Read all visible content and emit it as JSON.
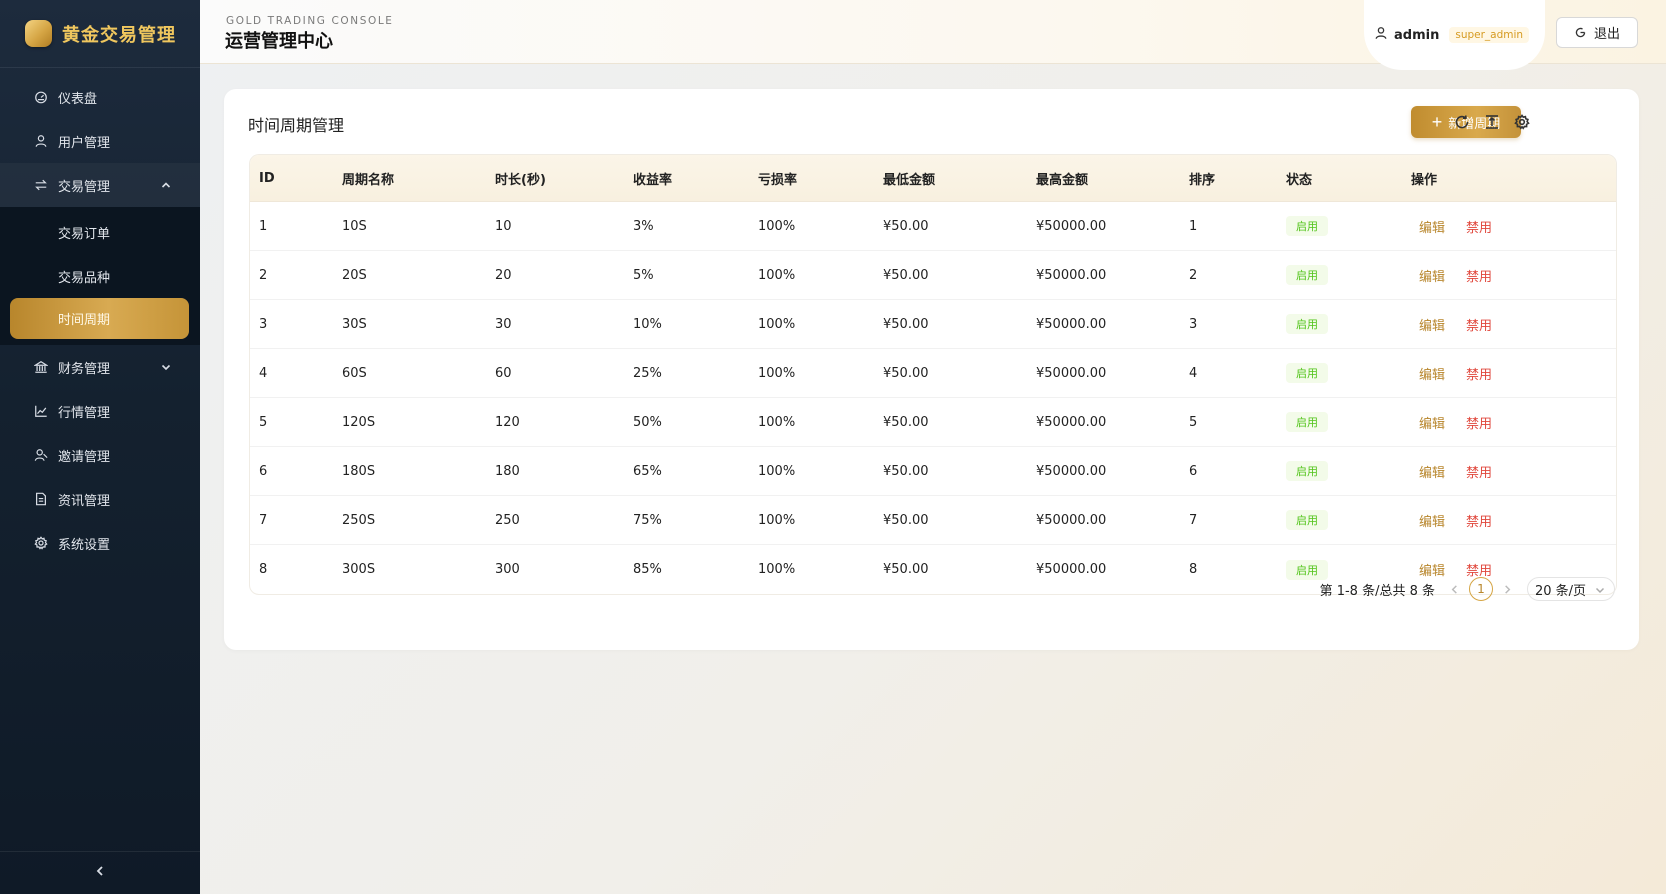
{
  "app": {
    "name": "黄金交易管理"
  },
  "sidebar": {
    "items": [
      {
        "label": "仪表盘",
        "icon": "dashboard-icon"
      },
      {
        "label": "用户管理",
        "icon": "user-icon"
      },
      {
        "label": "交易管理",
        "icon": "swap-icon",
        "expanded": true,
        "children": [
          {
            "label": "交易订单"
          },
          {
            "label": "交易品种"
          },
          {
            "label": "时间周期",
            "active": true
          }
        ]
      },
      {
        "label": "财务管理",
        "icon": "bank-icon",
        "expanded": false
      },
      {
        "label": "行情管理",
        "icon": "line-chart-icon"
      },
      {
        "label": "邀请管理",
        "icon": "invite-icon"
      },
      {
        "label": "资讯管理",
        "icon": "document-icon"
      },
      {
        "label": "系统设置",
        "icon": "gear-icon"
      }
    ]
  },
  "header": {
    "subtitle": "GOLD TRADING CONSOLE",
    "title": "运营管理中心",
    "user": {
      "name": "admin",
      "role": "super_admin"
    },
    "logout_label": "退出"
  },
  "card": {
    "title": "时间周期管理",
    "add_button_label": "新增周期"
  },
  "table": {
    "columns": [
      "ID",
      "周期名称",
      "时长(秒)",
      "收益率",
      "亏损率",
      "最低金额",
      "最高金额",
      "排序",
      "状态",
      "操作"
    ],
    "rows": [
      {
        "id": "1",
        "name": "10S",
        "duration": "10",
        "profit": "3%",
        "loss": "100%",
        "min": "¥50.00",
        "max": "¥50000.00",
        "sort": "1",
        "status": "启用"
      },
      {
        "id": "2",
        "name": "20S",
        "duration": "20",
        "profit": "5%",
        "loss": "100%",
        "min": "¥50.00",
        "max": "¥50000.00",
        "sort": "2",
        "status": "启用"
      },
      {
        "id": "3",
        "name": "30S",
        "duration": "30",
        "profit": "10%",
        "loss": "100%",
        "min": "¥50.00",
        "max": "¥50000.00",
        "sort": "3",
        "status": "启用"
      },
      {
        "id": "4",
        "name": "60S",
        "duration": "60",
        "profit": "25%",
        "loss": "100%",
        "min": "¥50.00",
        "max": "¥50000.00",
        "sort": "4",
        "status": "启用"
      },
      {
        "id": "5",
        "name": "120S",
        "duration": "120",
        "profit": "50%",
        "loss": "100%",
        "min": "¥50.00",
        "max": "¥50000.00",
        "sort": "5",
        "status": "启用"
      },
      {
        "id": "6",
        "name": "180S",
        "duration": "180",
        "profit": "65%",
        "loss": "100%",
        "min": "¥50.00",
        "max": "¥50000.00",
        "sort": "6",
        "status": "启用"
      },
      {
        "id": "7",
        "name": "250S",
        "duration": "250",
        "profit": "75%",
        "loss": "100%",
        "min": "¥50.00",
        "max": "¥50000.00",
        "sort": "7",
        "status": "启用"
      },
      {
        "id": "8",
        "name": "300S",
        "duration": "300",
        "profit": "85%",
        "loss": "100%",
        "min": "¥50.00",
        "max": "¥50000.00",
        "sort": "8",
        "status": "启用"
      }
    ],
    "actions": {
      "edit": "编辑",
      "disable": "禁用"
    }
  },
  "pagination": {
    "summary": "第 1-8 条/总共 8 条",
    "current_page": "1",
    "page_size": "20 条/页"
  },
  "colors": {
    "accent_gold": "#d5a544",
    "sidebar_bg": "#14212f",
    "status_green": "#52c41a",
    "danger_red": "#e0473c"
  }
}
